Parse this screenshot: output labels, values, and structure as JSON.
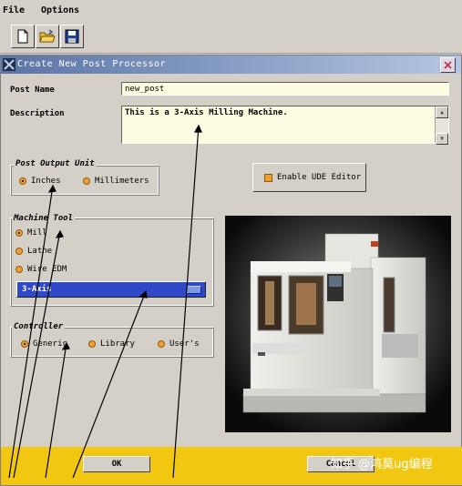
{
  "menu": {
    "file_label": "File",
    "options_label": "Options"
  },
  "toolbar": {
    "icons": [
      "new-file-icon",
      "open-folder-icon",
      "save-icon"
    ]
  },
  "dialog": {
    "title": "Create New Post Processor",
    "post_name_label": "Post Name",
    "post_name_value": "new_post",
    "description_label": "Description",
    "description_value": "This is a 3-Axis Milling Machine.",
    "output_unit": {
      "title": "Post Output Unit",
      "options": [
        "Inches",
        "Millimeters"
      ],
      "selected": "Inches"
    },
    "ude_editor_label": "Enable UDE Editor",
    "machine_tool": {
      "title": "Machine Tool",
      "options": [
        "Mill",
        "Lathe",
        "Wire EDM"
      ],
      "selected": "Mill",
      "axis_selected": "3-Axis"
    },
    "controller": {
      "title": "Controller",
      "options": [
        "Generic",
        "Library",
        "User's"
      ],
      "selected": "Generic"
    },
    "ok_label": "OK",
    "cancel_label": "Cancel"
  },
  "watermark": "知乎 @鸿莫ug编程",
  "colors": {
    "title_gradient_start": "#5a74a6",
    "bottom_bar": "#f1c712",
    "selection_blue": "#3049c8",
    "radio_orange": "#f0a030"
  }
}
